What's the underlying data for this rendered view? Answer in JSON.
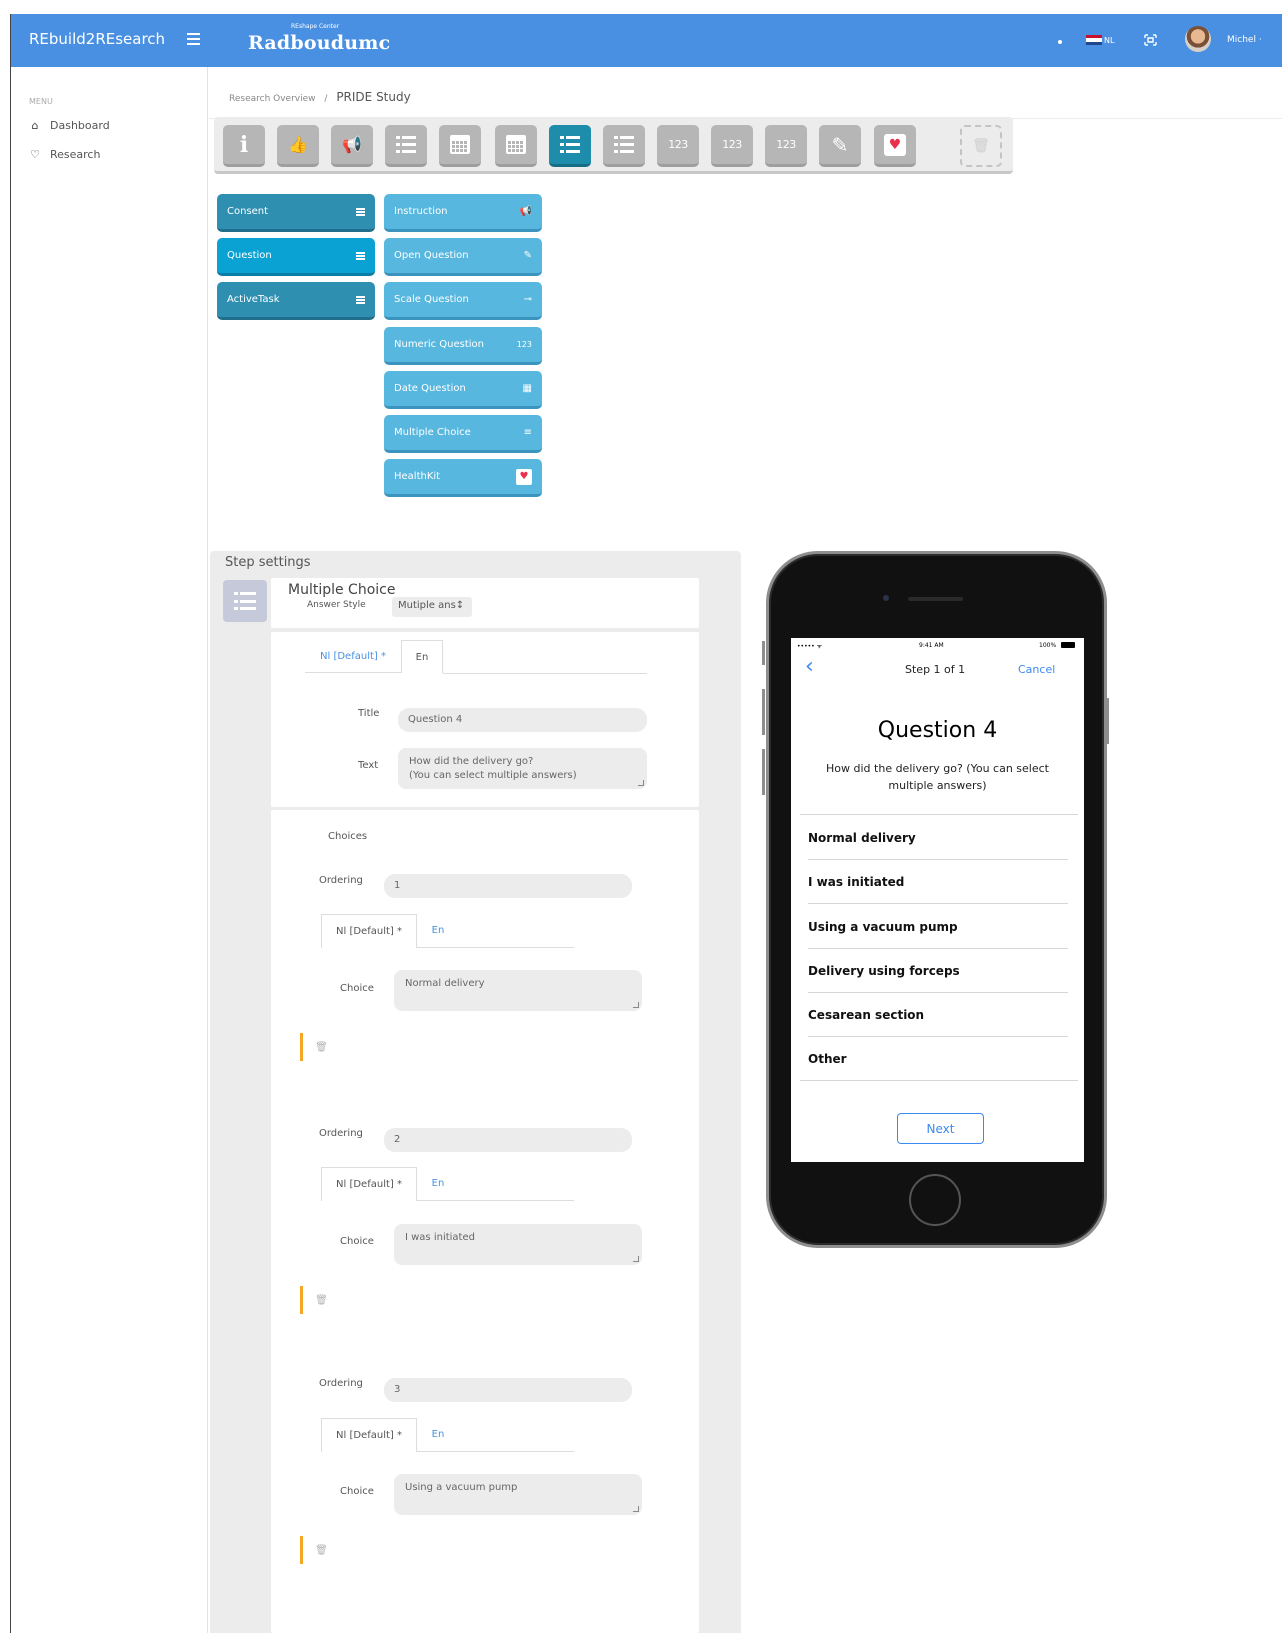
{
  "app": {
    "brand": "REbuild2REsearch",
    "logo_small": "REshape Center",
    "logo": "Radboudumc",
    "language": "NL",
    "user": "Michel ·"
  },
  "sidebar": {
    "menu_label": "MENU",
    "items": [
      {
        "label": "Dashboard",
        "icon": "home-icon"
      },
      {
        "label": "Research",
        "icon": "heart-outline-icon"
      }
    ]
  },
  "breadcrumb": {
    "parent": "Research Overview",
    "separator": "/",
    "current": "PRIDE Study"
  },
  "toolbar": {
    "tools": [
      {
        "icon": "info-icon",
        "glyph": "i"
      },
      {
        "icon": "thumbs-up-icon",
        "glyph": "👍"
      },
      {
        "icon": "megaphone-icon",
        "glyph": "📢"
      },
      {
        "icon": "list-icon"
      },
      {
        "icon": "calendar-icon"
      },
      {
        "icon": "calendar-icon"
      },
      {
        "icon": "list-icon",
        "active": true
      },
      {
        "icon": "list-icon"
      },
      {
        "icon": "numeric-icon",
        "glyph": "123"
      },
      {
        "icon": "numeric-icon",
        "glyph": "123"
      },
      {
        "icon": "numeric-icon",
        "glyph": "123"
      },
      {
        "icon": "pencil-icon",
        "glyph": "✎"
      },
      {
        "icon": "healthkit-heart-icon",
        "glyph": "♥"
      },
      {
        "icon": "trash-icon",
        "glyph": "🗑"
      }
    ]
  },
  "step_types": {
    "categories": [
      {
        "label": "Consent",
        "icon": "menu-icon"
      },
      {
        "label": "Question",
        "icon": "menu-icon"
      },
      {
        "label": "ActiveTask",
        "icon": "menu-icon"
      }
    ],
    "questions": [
      {
        "label": "Instruction",
        "icon": "megaphone-icon",
        "glyph": "📢"
      },
      {
        "label": "Open Question",
        "icon": "pencil-icon",
        "glyph": "✎"
      },
      {
        "label": "Scale Question",
        "icon": "slider-icon",
        "glyph": "⊸"
      },
      {
        "label": "Numeric Question",
        "icon": "numeric-icon",
        "glyph": "123"
      },
      {
        "label": "Date Question",
        "icon": "calendar-icon",
        "glyph": "▦"
      },
      {
        "label": "Multiple Choice",
        "icon": "list-icon",
        "glyph": "≡"
      },
      {
        "label": "HealthKit",
        "icon": "healthkit-heart-icon",
        "glyph": "♥"
      }
    ]
  },
  "step_settings": {
    "panel_title": "Step settings",
    "type_title": "Multiple Choice",
    "answer_style_label": "Answer Style",
    "answer_style_value": "Mutiple ans↕",
    "tabs": {
      "default": "Nl [Default] *",
      "en": "En"
    },
    "title_label": "Title",
    "title_value": "Question 4",
    "text_label": "Text",
    "text_value_line1": "How did the delivery go?",
    "text_value_line2": "(You can select multiple answers)",
    "choices_label": "Choices",
    "ordering_label": "Ordering",
    "choice_label": "Choice",
    "choices": [
      {
        "ordering": "1",
        "text": "Normal delivery"
      },
      {
        "ordering": "2",
        "text": "I was initiated"
      },
      {
        "ordering": "3",
        "text": "Using a  vacuum pump"
      }
    ]
  },
  "preview": {
    "status_left": "••••• ᯤ",
    "status_time": "9:41 AM",
    "status_battery": "100%",
    "back": "‹",
    "step_label": "Step 1 of 1",
    "cancel": "Cancel",
    "title": "Question 4",
    "text": "How did the delivery go? (You can select multiple answers)",
    "choices": [
      "Normal delivery",
      "I was initiated",
      "Using a vacuum pump",
      "Delivery using forceps",
      "Cesarean section",
      "Other"
    ],
    "next": "Next"
  },
  "colors": {
    "topbar": "#4a90e2",
    "step_dark": "#2f8fb1",
    "step_selected": "#0aa1d3",
    "step_light": "#58b7df",
    "accent_orange": "#f5a623",
    "ios_blue": "#3b8af0"
  }
}
